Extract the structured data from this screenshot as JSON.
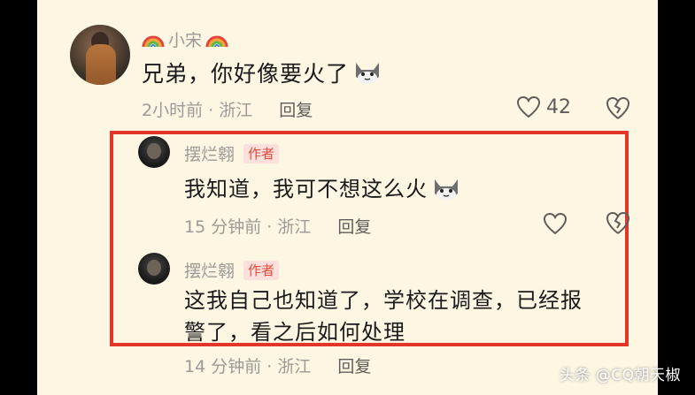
{
  "comment": {
    "username": "小宋",
    "text": "兄弟，你好像要火了",
    "time_location": "2小时前 · 浙江",
    "reply_label": "回复",
    "like_count": "42"
  },
  "replies": [
    {
      "username": "摆烂翱",
      "badge": "作者",
      "lines": [
        "我知道，我可不想这么火"
      ],
      "time_location": "15 分钟前 · 浙江",
      "reply_label": "回复"
    },
    {
      "username": "摆烂翱",
      "badge": "作者",
      "lines": [
        "这我自己也知道了，学校在调查，已经报",
        "警了，看之后如何处理"
      ],
      "time_location": "14 分钟前 · 浙江",
      "reply_label": "回复"
    }
  ],
  "watermark": "头条 @CQ朝天椒",
  "colors": {
    "background": "#fcf6e3",
    "highlight_box": "#e4352a",
    "author_badge_bg": "#fde0dc",
    "author_badge_text": "#e34a3b"
  },
  "icons": {
    "username_decoration": "rainbow-icon",
    "emoji": "cat-face-icon",
    "like": "heart-outline-icon",
    "dislike": "broken-heart-icon"
  }
}
